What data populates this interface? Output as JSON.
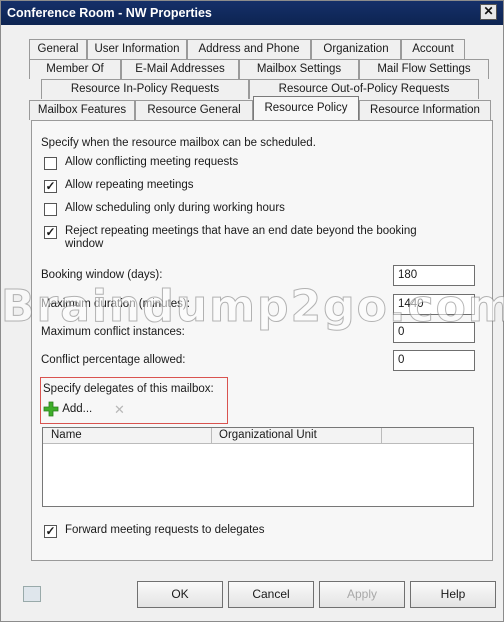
{
  "window": {
    "title": "Conference Room - NW Properties",
    "close": "✕"
  },
  "tabs": {
    "row1": [
      "General",
      "User Information",
      "Address and Phone",
      "Organization",
      "Account"
    ],
    "row2": [
      "Member Of",
      "E-Mail Addresses",
      "Mailbox Settings",
      "Mail Flow Settings"
    ],
    "row3": [
      "Resource In-Policy Requests",
      "Resource Out-of-Policy Requests"
    ],
    "row4": [
      "Mailbox Features",
      "Resource General",
      "Resource Policy",
      "Resource Information"
    ],
    "active": "Resource Policy"
  },
  "policy": {
    "intro": "Specify when the resource mailbox can be scheduled.",
    "options": [
      {
        "label": "Allow conflicting meeting requests",
        "checked": false
      },
      {
        "label": "Allow repeating meetings",
        "checked": true
      },
      {
        "label": "Allow scheduling only during working hours",
        "checked": false
      },
      {
        "label": "Reject repeating meetings that have an end date beyond the booking",
        "label2": "window",
        "checked": true
      }
    ],
    "fields": [
      {
        "label": "Booking window (days):",
        "value": "180"
      },
      {
        "label": "Maximum duration (minutes):",
        "value": "1440"
      },
      {
        "label": "Maximum conflict instances:",
        "value": "0"
      },
      {
        "label": "Conflict percentage allowed:",
        "value": "0"
      }
    ]
  },
  "delegates": {
    "heading": "Specify delegates of this mailbox:",
    "add_label": "Add...",
    "remove_icon": "✕",
    "columns": [
      "Name",
      "Organizational Unit"
    ],
    "forward_label": "Forward meeting requests to delegates",
    "forward_checked": true
  },
  "footer": {
    "ok": "OK",
    "cancel": "Cancel",
    "apply": "Apply",
    "help": "Help"
  },
  "watermark": "Braindump2go.com",
  "colors": {
    "title_bar": "#15306a",
    "highlight_border": "#d9534f",
    "add_icon": "#3fae2a"
  }
}
